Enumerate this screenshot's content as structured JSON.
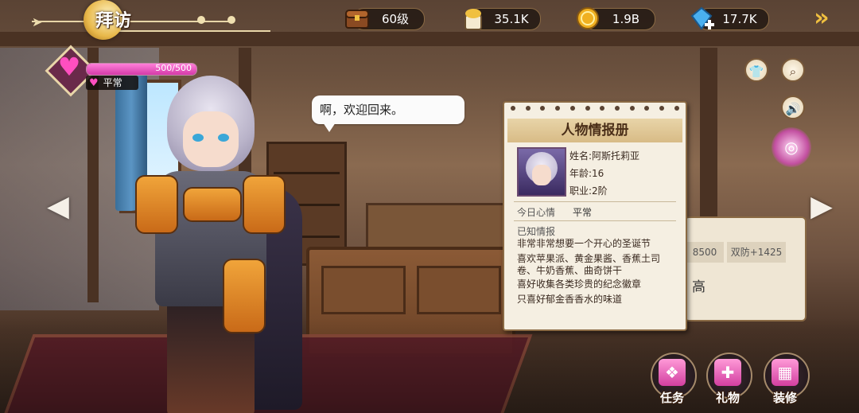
{
  "header": {
    "title": "拜访",
    "back_icon": "double-chevron-right-icon"
  },
  "resources": [
    {
      "icon": "treasure-chest-icon",
      "value": "60级"
    },
    {
      "icon": "food-bowl-icon",
      "value": "35.1K"
    },
    {
      "icon": "gold-coin-icon",
      "value": "1.9B"
    },
    {
      "icon": "diamond-plus-icon",
      "value": "17.7K"
    }
  ],
  "affection": {
    "hp_text": "500/500",
    "fill_ratio": 1.0,
    "mood_label": "平常",
    "bar_color": "#e052b8"
  },
  "dialog": {
    "text": "啊，欢迎回来。"
  },
  "profile": {
    "heading": "人物情报册",
    "name": "姓名:阿斯托莉亚",
    "age": "年龄:16",
    "job": "职业:2阶",
    "mood_label": "今日心情",
    "mood_value": "平常",
    "known_label": "已知情报",
    "facts": [
      "非常非常想要一个开心的圣诞节",
      "喜欢苹果派、黄金果酱、香蕉土司卷、牛奶香蕉、曲奇饼干",
      "喜好收集各类珍贵的纪念徽章",
      "只喜好郁金香香水的味道"
    ]
  },
  "stats_panel": {
    "stat_a": "8500",
    "stat_b": "双防+1425",
    "stat_c": "高"
  },
  "side_buttons": [
    "shirt-icon",
    "search-icon",
    "speaker-icon",
    "ring-icon"
  ],
  "bottom_buttons": [
    {
      "label": "任务",
      "icon": "quest-book-icon"
    },
    {
      "label": "礼物",
      "icon": "gift-box-icon"
    },
    {
      "label": "装修",
      "icon": "furniture-icon"
    }
  ]
}
